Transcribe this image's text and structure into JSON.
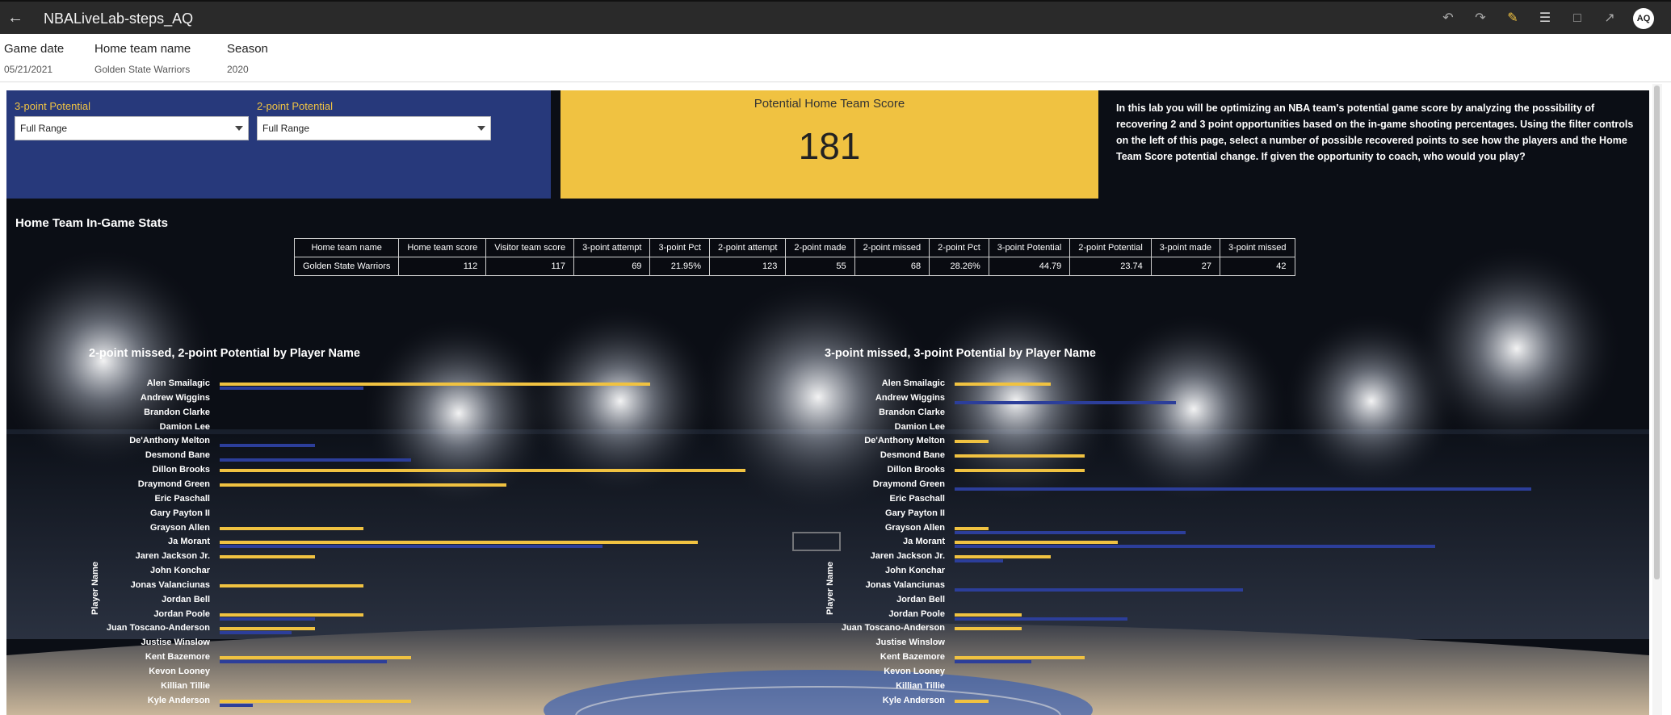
{
  "app": {
    "title": "NBALiveLab-steps_AQ",
    "back_icon": "arrow-left-icon",
    "user_initials": "AQ",
    "toolbar_icons": [
      "undo-icon",
      "redo-icon",
      "edit-icon",
      "data-icon",
      "comment-icon",
      "export-icon"
    ]
  },
  "filters": [
    {
      "label": "Game date",
      "value": "05/21/2021"
    },
    {
      "label": "Home team name",
      "value": "Golden State Warriors"
    },
    {
      "label": "Season",
      "value": "2020"
    }
  ],
  "controls": {
    "three_point_label": "3-point Potential",
    "three_point_value": "Full Range",
    "two_point_label": "2-point Potential",
    "two_point_value": "Full Range"
  },
  "kpi": {
    "title": "Potential Home Team Score",
    "value": "181"
  },
  "intro_text": "In this lab you will be optimizing an NBA team's potential game score by analyzing the possibility of recovering 2 and 3 point opportunities based on the in-game shooting percentages. Using the filter controls on the left of this page, select a number of possible recovered points to see how the players and the Home Team Score potential change. If given the opportunity to coach, who would you play?",
  "stats": {
    "title": "Home Team In-Game Stats",
    "headers": [
      "Home team name",
      "Home team score",
      "Visitor team score",
      "3-point attempt",
      "3-point Pct",
      "2-point attempt",
      "2-point made",
      "2-point missed",
      "2-point Pct",
      "3-point Potential",
      "2-point Potential",
      "3-point made",
      "3-point missed"
    ],
    "row": [
      "Golden State Warriors",
      "112",
      "117",
      "69",
      "21.95%",
      "123",
      "55",
      "68",
      "28.26%",
      "44.79",
      "23.74",
      "27",
      "42"
    ]
  },
  "colors": {
    "yellow": "#f0c241",
    "blue": "#27397b",
    "bar_blue": "#2c3e9a"
  },
  "chart_data": [
    {
      "type": "bar",
      "title": "2-point missed, 2-point Potential by Player Name",
      "ylabel": "Player Name",
      "categories": [
        "Alen Smailagic",
        "Andrew Wiggins",
        "Brandon Clarke",
        "Damion Lee",
        "De'Anthony Melton",
        "Desmond Bane",
        "Dillon Brooks",
        "Draymond Green",
        "Eric Paschall",
        "Gary Payton II",
        "Grayson Allen",
        "Ja Morant",
        "Jaren Jackson Jr.",
        "John Konchar",
        "Jonas Valanciunas",
        "Jordan Bell",
        "Jordan Poole",
        "Juan Toscano-Anderson",
        "Justise Winslow",
        "Kent Bazemore",
        "Kevon Looney",
        "Killian Tillie",
        "Kyle Anderson"
      ],
      "series": [
        {
          "name": "2-point Potential",
          "color": "#f0c241",
          "values": [
            9.0,
            0,
            0,
            0,
            0,
            0,
            11.0,
            6.0,
            0,
            0,
            3.0,
            10.0,
            2.0,
            0,
            3.0,
            0,
            3.0,
            2.0,
            0,
            4.0,
            0,
            0,
            4.0
          ]
        },
        {
          "name": "2-point missed",
          "color": "#2c3e9a",
          "values": [
            3,
            0,
            0,
            0,
            2,
            4,
            0,
            0,
            0,
            0,
            0,
            8,
            0,
            0,
            0,
            0,
            2,
            1.5,
            0,
            3.5,
            0,
            0,
            0.7
          ]
        }
      ]
    },
    {
      "type": "bar",
      "title": "3-point missed, 3-point Potential by Player Name",
      "ylabel": "Player Name",
      "categories": [
        "Alen Smailagic",
        "Andrew Wiggins",
        "Brandon Clarke",
        "Damion Lee",
        "De'Anthony Melton",
        "Desmond Bane",
        "Dillon Brooks",
        "Draymond Green",
        "Eric Paschall",
        "Gary Payton II",
        "Grayson Allen",
        "Ja Morant",
        "Jaren Jackson Jr.",
        "John Konchar",
        "Jonas Valanciunas",
        "Jordan Bell",
        "Jordan Poole",
        "Juan Toscano-Anderson",
        "Justise Winslow",
        "Kent Bazemore",
        "Kevon Looney",
        "Killian Tillie",
        "Kyle Anderson"
      ],
      "series": [
        {
          "name": "3-point Potential",
          "color": "#f0c241",
          "values": [
            1.0,
            0,
            0,
            0,
            0.35,
            1.35,
            1.35,
            0,
            0,
            0,
            0.35,
            1.7,
            1.0,
            0,
            0,
            0,
            0.7,
            0.7,
            0,
            1.35,
            0,
            0,
            0.35
          ]
        },
        {
          "name": "3-point missed",
          "color": "#2c3e9a",
          "values": [
            0,
            2.3,
            0,
            0,
            0,
            0,
            0,
            6.0,
            0,
            0,
            2.4,
            5.0,
            0.5,
            0,
            3.0,
            0,
            1.8,
            0,
            0,
            0.8,
            0,
            0,
            0
          ]
        }
      ]
    }
  ]
}
